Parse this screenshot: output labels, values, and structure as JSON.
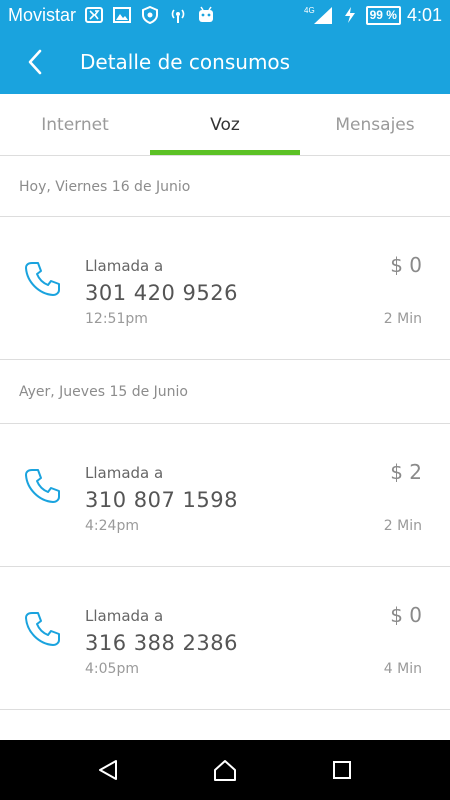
{
  "status_bar": {
    "carrier": "Movistar",
    "network": "4G",
    "battery": "99 %",
    "time": "4:01"
  },
  "app_bar": {
    "title": "Detalle de consumos"
  },
  "tabs": [
    {
      "label": "Internet",
      "active": false
    },
    {
      "label": "Voz",
      "active": true
    },
    {
      "label": "Mensajes",
      "active": false
    }
  ],
  "sections": [
    {
      "date": "Hoy, Viernes 16 de Junio",
      "calls": [
        {
          "label": "Llamada a",
          "number": "301 420 9526",
          "time": "12:51pm",
          "cost": "$ 0",
          "duration": "2 Min"
        }
      ]
    },
    {
      "date": "Ayer, Jueves 15 de Junio",
      "calls": [
        {
          "label": "Llamada a",
          "number": "310 807 1598",
          "time": "4:24pm",
          "cost": "$ 2",
          "duration": "2 Min"
        },
        {
          "label": "Llamada a",
          "number": "316 388 2386",
          "time": "4:05pm",
          "cost": "$ 0",
          "duration": "4 Min"
        }
      ]
    }
  ],
  "colors": {
    "primary": "#1aa3de",
    "tab_indicator": "#5cc125",
    "phone_icon": "#1aa3de"
  },
  "icons": {
    "back": "chevron-left-icon",
    "call": "phone-icon"
  }
}
